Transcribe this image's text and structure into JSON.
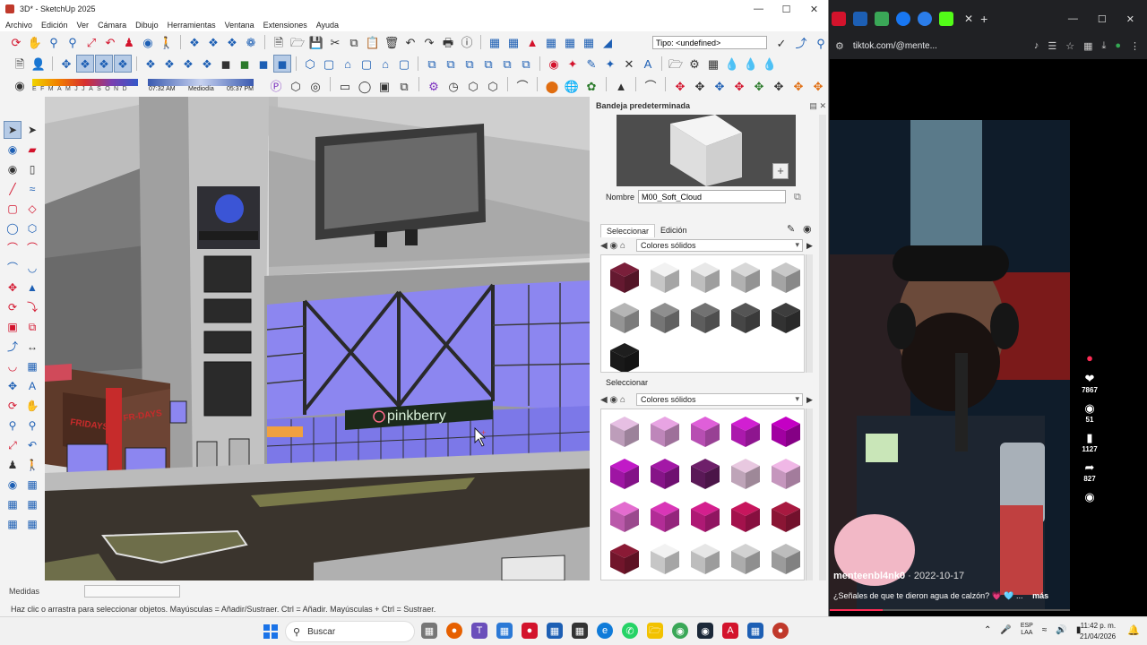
{
  "sketchup": {
    "title": "3D* - SketchUp 2025",
    "menu": [
      "Archivo",
      "Edición",
      "Ver",
      "Cámara",
      "Dibujo",
      "Herramientas",
      "Ventana",
      "Extensiones",
      "Ayuda"
    ],
    "tipo_field": "Tipo: <undefined>",
    "sun_letters": "EFMAMJJASOND",
    "time_start": "07:32 AM",
    "time_mid": "Mediodía",
    "time_end": "05:37 PM",
    "viewport": {
      "sign_store": "pinkberry",
      "sign_bar_left": "FRIDAYS",
      "sign_bar_right": "FR-DAYS"
    },
    "status": {
      "medidas_label": "Medidas",
      "help_text": "Haz clic o arrastra para seleccionar objetos. Mayúsculas = Añadir/Sustraer. Ctrl = Añadir. Mayúsculas + Ctrl = Sustraer."
    },
    "tray": {
      "title": "Bandeja predeterminada",
      "nombre_label": "Nombre",
      "nombre_value": "M00_Soft_Cloud",
      "tab_select": "Seleccionar",
      "tab_edit": "Edición",
      "library_top": "Colores sólidos",
      "section2_label": "Seleccionar",
      "library_bottom": "Colores sólidos",
      "swatches_top": [
        "#7a1f3a",
        "#f2f2f2",
        "#e8e8e8",
        "#d8d8d8",
        "#c8c8c8",
        "#b5b5b5",
        "#8f8f8f",
        "#727272",
        "#555555",
        "#3d3d3d",
        "#1e1e1e"
      ],
      "swatches_bottom": [
        "#e6bfe3",
        "#e8a4e3",
        "#df5fd9",
        "#d11fd2",
        "#c400c4",
        "#c11ac7",
        "#a318a6",
        "#6e1f6a",
        "#e8c8e0",
        "#f0b7e6",
        "#e36ccf",
        "#d936b7",
        "#d41f8e",
        "#c7165d",
        "#a81940",
        "#8a1a35",
        "#f2f2f2",
        "#e6e6e6",
        "#d2d2d2",
        "#bdbdbd"
      ]
    }
  },
  "browser": {
    "url": "tiktok.com/@mente...",
    "tiktok": {
      "author": "menteenbl4nk0",
      "date": "2022-10-17",
      "caption": "¿Señales de que te dieron agua de calzón? 💗 🩵 ...",
      "more": "más",
      "likes": "7867",
      "comments": "51",
      "saves": "1127",
      "shares": "827"
    }
  },
  "taskbar": {
    "search_placeholder": "Buscar",
    "lang_top": "ESP",
    "lang_bottom": "LAA",
    "time": "11:42 p. m.",
    "date": "21/04/2026"
  }
}
